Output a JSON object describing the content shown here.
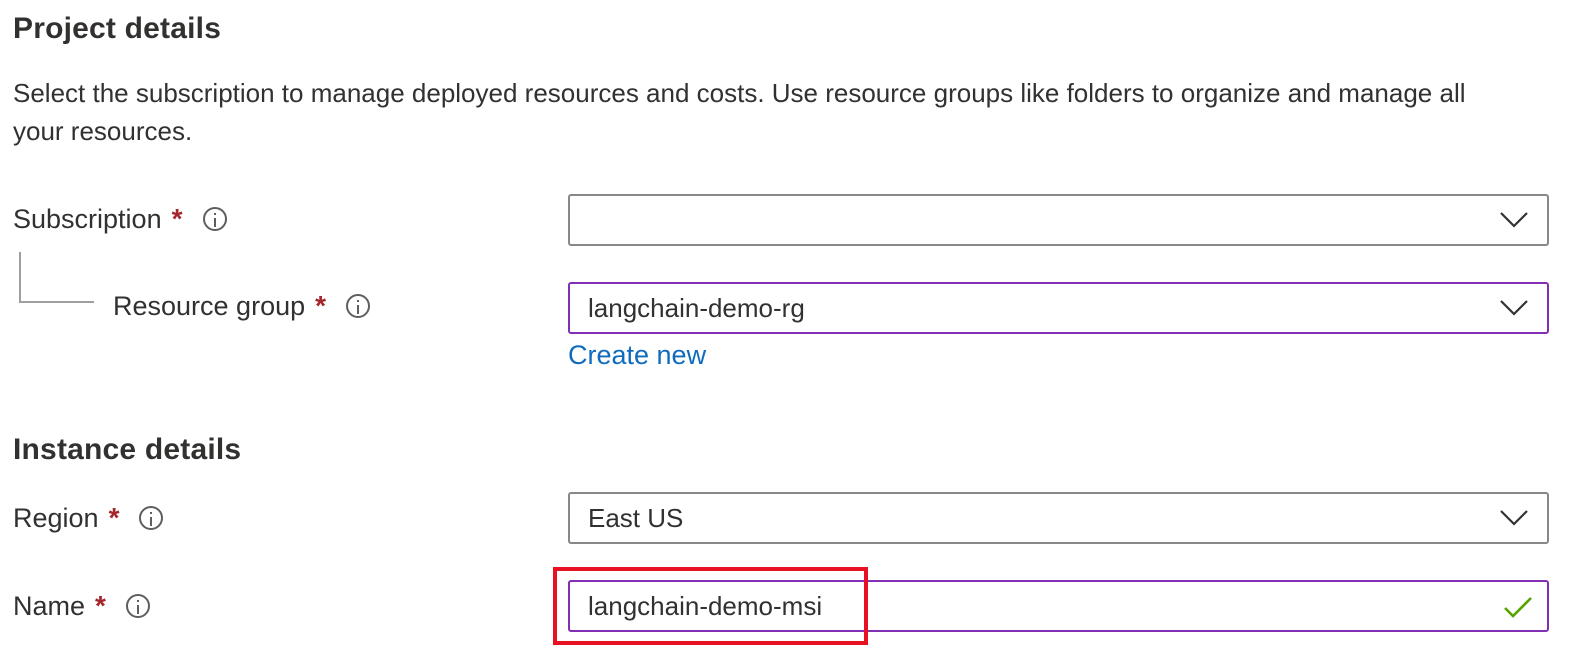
{
  "project": {
    "title": "Project details",
    "description": "Select the subscription to manage deployed resources and costs. Use resource groups like folders to organize and manage all your resources."
  },
  "subscription": {
    "label": "Subscription",
    "required_mark": "*",
    "value": ""
  },
  "resource_group": {
    "label": "Resource group",
    "required_mark": "*",
    "value": "langchain-demo-rg",
    "create_new": "Create new"
  },
  "instance": {
    "title": "Instance details"
  },
  "region": {
    "label": "Region",
    "required_mark": "*",
    "value": "East US"
  },
  "name": {
    "label": "Name",
    "required_mark": "*",
    "value": "langchain-demo-msi",
    "valid": true
  },
  "colors": {
    "required": "#a4262c",
    "link": "#0f6cbd",
    "active_border": "#8230b3",
    "highlight": "#e81123",
    "valid_check": "#57a300"
  },
  "icons": {
    "info": "info-icon",
    "chevron": "chevron-down-icon",
    "check": "checkmark-icon"
  }
}
